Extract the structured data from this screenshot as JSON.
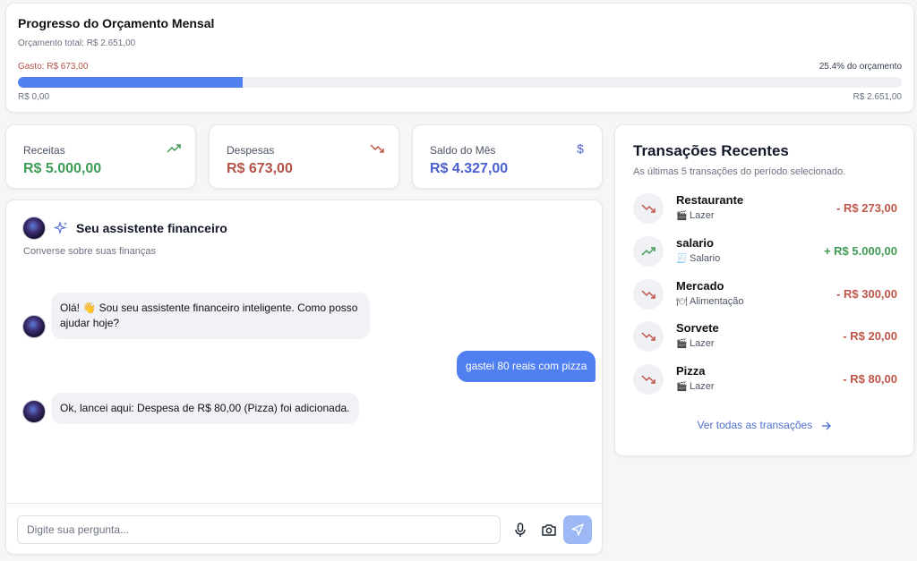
{
  "budget": {
    "title": "Progresso do Orçamento Mensal",
    "total": "Orçamento total: R$ 2.651,00",
    "spent": "Gasto: R$ 673,00",
    "percent_label": "25.4% do orçamento",
    "progress_fraction": 0.254,
    "min": "R$ 0,00",
    "max": "R$ 2.651,00"
  },
  "stats": {
    "income": {
      "label": "Receitas",
      "value": "R$ 5.000,00",
      "icon": "trending-up-icon",
      "color": "#3f9b55"
    },
    "expense": {
      "label": "Despesas",
      "value": "R$ 673,00",
      "icon": "trending-down-icon",
      "color": "#b45347"
    },
    "balance": {
      "label": "Saldo do Mês",
      "value": "R$ 4.327,00",
      "icon": "dollar-icon",
      "color": "#4a5fd0"
    }
  },
  "chat": {
    "title": "Seu assistente financeiro",
    "subtitle": "Converse sobre suas finanças",
    "messages": [
      {
        "role": "bot",
        "text": "Olá! 👋 Sou seu assistente financeiro inteligente. Como posso ajudar hoje?"
      },
      {
        "role": "user",
        "text": "gastei 80 reais com pizza"
      },
      {
        "role": "bot",
        "text": "Ok, lancei aqui: Despesa de R$ 80,00 (Pizza) foi adicionada."
      }
    ],
    "input_placeholder": "Digite sua pergunta..."
  },
  "transactions": {
    "title": "Transações Recentes",
    "subtitle": "As últimas 5 transações do período selecionado.",
    "items": [
      {
        "name": "Restaurante",
        "category": "Lazer",
        "amount": "- R$ 273,00",
        "type": "expense"
      },
      {
        "name": "salario",
        "category": "Salario",
        "amount": "+ R$ 5.000,00",
        "type": "income"
      },
      {
        "name": "Mercado",
        "category": "Alimentação",
        "amount": "- R$ 300,00",
        "type": "expense"
      },
      {
        "name": "Sorvete",
        "category": "Lazer",
        "amount": "- R$ 20,00",
        "type": "expense"
      },
      {
        "name": "Pizza",
        "category": "Lazer",
        "amount": "- R$ 80,00",
        "type": "expense"
      }
    ],
    "see_all": "Ver todas as transações"
  }
}
